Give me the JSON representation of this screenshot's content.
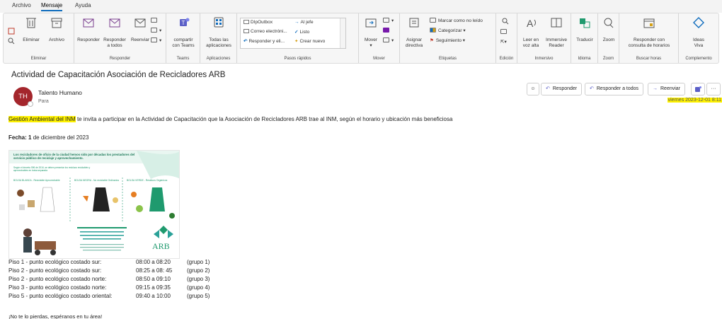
{
  "menu": {
    "tabs": [
      "Archivo",
      "Mensaje",
      "Ayuda"
    ],
    "active": "Mensaje"
  },
  "ribbon": {
    "groups": {
      "eliminar": "Eliminar",
      "responder": "Responder",
      "teams": "Teams",
      "aplicaciones": "Aplicaciones",
      "pasos": "Pasos rápidos",
      "mover": "Mover",
      "etiquetas": "Etiquetas",
      "edicion": "Edición",
      "inmersivo": "Inmersivo",
      "idioma": "Idioma",
      "zoom": "Zoom",
      "buscar_horas": "Buscar horas",
      "complemento": "Complemento"
    },
    "buttons": {
      "eliminar": "Eliminar",
      "archivo": "Archivo",
      "responder": "Responder",
      "responder_todos_1": "Responder",
      "responder_todos_2": "a todos",
      "reenviar": "Reenviar",
      "compartir_1": "compartir",
      "compartir_2": "con Teams",
      "todas_apps_1": "Todas las",
      "todas_apps_2": "aplicaciones",
      "mover": "Mover",
      "asignar_1": "Asignar",
      "asignar_2": "directiva",
      "marcar_no_leido": "Marcar como no leído",
      "categorizar": "Categorizar",
      "seguimiento": "Seguimiento",
      "leer_voz_1": "Leer en",
      "leer_voz_2": "voz alta",
      "immersive_1": "Immersive",
      "immersive_2": "Reader",
      "traducir": "Traducir",
      "zoom": "Zoom",
      "responder_consulta_1": "Responder con",
      "responder_consulta_2": "consulta de horarios",
      "ideas_1": "Ideas",
      "ideas_2": "Viva"
    },
    "quick_steps": {
      "dip_outbox": "DIpOutbox",
      "al_jefe": "Al jefe",
      "correo": "Correo electróni...",
      "listo": "Listo",
      "responder_eli": "Responder y eli...",
      "crear_nuevo": "Crear nuevo"
    }
  },
  "message": {
    "subject": "Actividad de Capacitación Asociación de Recicladores ARB",
    "avatar_initials": "TH",
    "sender": "Talento Humano",
    "to_label": "Para",
    "actions": {
      "responder": "Responder",
      "responder_todos": "Responder a todos",
      "reenviar": "Reenviar",
      "more": "···"
    },
    "date": "viernes 2023-12-01 8:11"
  },
  "body": {
    "intro_highlight": "Gestión Ambiental del INM",
    "intro_rest": " te invita a participar en la Actividad de Capacitación que la Asociación de Recicladores ARB trae al INM, según el horario y ubicación más beneficiosa",
    "fecha_label": "Fecha:",
    "fecha_bold": "1",
    "fecha_rest": " de diciembre del 2023",
    "schedule": [
      {
        "place": "Piso 1 - punto ecológico costado sur:",
        "time": "08:00 a 08:20",
        "group": "(grupo 1)"
      },
      {
        "place": "Piso 2 - punto ecológico costado sur:",
        "time": "08:25 a 08: 45",
        "group": "(grupo 2)"
      },
      {
        "place": "Piso 2 - punto ecológico costado norte:",
        "time": "08:50 a 09:10",
        "group": "(grupo 3)"
      },
      {
        "place": "Piso 3 - punto ecológico costado norte:",
        "time": "09:15 a 09:35",
        "group": "(grupo 4)"
      },
      {
        "place": "Piso 5 - punto ecológico  costado oriental:",
        "time": "09:40 a 10:00",
        "group": "(grupo 5)"
      }
    ],
    "closing": "¡No te lo pierdas, espéranos en tu área!"
  },
  "poster": {
    "intro": "Los recicladores de oficio de la ciudad hemos sido por décadas los prestadores del servicio público de reciclaje y aprovechamiento.",
    "note": "Según el decreto 596 de 2016, se deben presentar los residuos reciclables y aprovechables en bolsa separada",
    "bag_white": "BOLSA BLANCA - Reciclable Aprovechable",
    "bag_black": "BOLSA NEGRA - No reciclable Ordinarios",
    "bag_green": "BOLSA VERDE - Residuos Orgánicos",
    "logo": "ARB"
  },
  "colors": {
    "accent": "#0f6cbd",
    "highlight": "#fff200",
    "avatar": "#a4262c",
    "poster_green": "#1f9a6e",
    "poster_teal": "#2aa198"
  }
}
